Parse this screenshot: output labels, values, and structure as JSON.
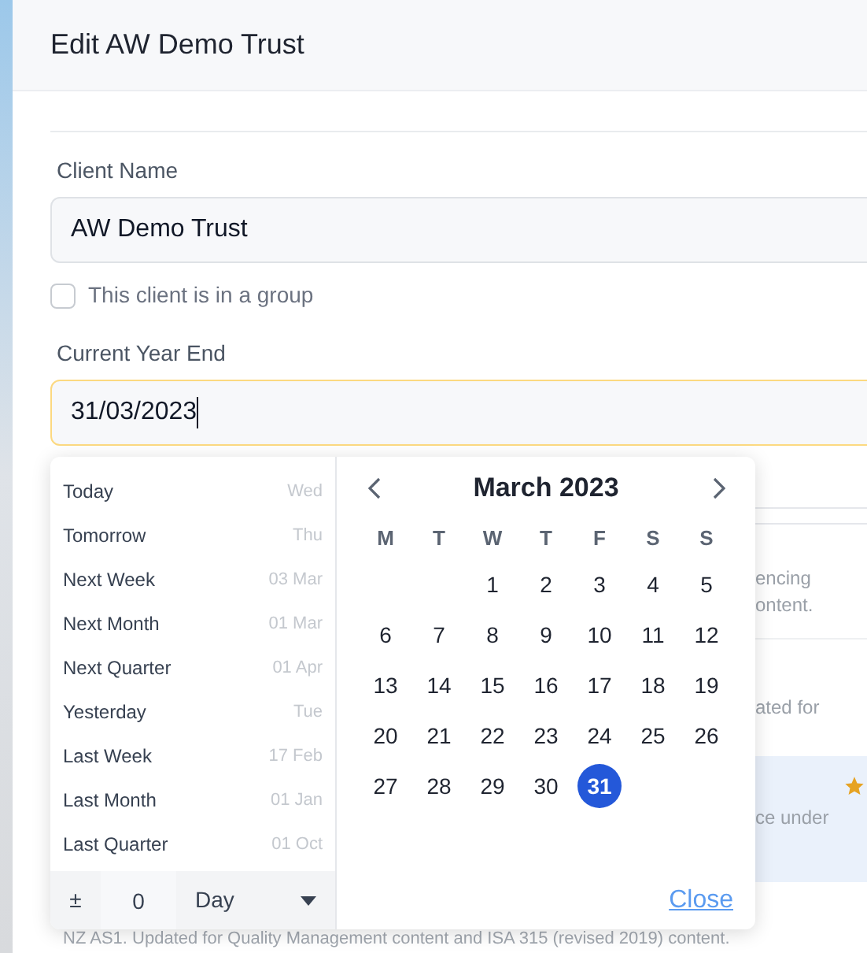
{
  "dialog": {
    "title": "Edit AW Demo Trust"
  },
  "client_name": {
    "label": "Client Name",
    "value": "AW Demo Trust"
  },
  "group_checkbox": {
    "label": "This client is in a group",
    "checked": false
  },
  "year_end": {
    "label": "Current Year End",
    "value": "31/03/2023"
  },
  "date_picker": {
    "shortcuts": [
      {
        "label": "Today",
        "hint": "Wed"
      },
      {
        "label": "Tomorrow",
        "hint": "Thu"
      },
      {
        "label": "Next Week",
        "hint": "03 Mar"
      },
      {
        "label": "Next Month",
        "hint": "01 Mar"
      },
      {
        "label": "Next Quarter",
        "hint": "01 Apr"
      },
      {
        "label": "Yesterday",
        "hint": "Tue"
      },
      {
        "label": "Last Week",
        "hint": "17 Feb"
      },
      {
        "label": "Last Month",
        "hint": "01 Jan"
      },
      {
        "label": "Last Quarter",
        "hint": "01 Oct"
      }
    ],
    "offset": {
      "sign": "±",
      "value": "0",
      "unit": "Day"
    },
    "month": "March 2023",
    "weekdays": [
      "M",
      "T",
      "W",
      "T",
      "F",
      "S",
      "S"
    ],
    "weeks": [
      [
        {
          "day": "1",
          "selected": false
        },
        {
          "day": "2",
          "selected": false
        },
        {
          "day": "3",
          "selected": false
        },
        {
          "day": "4",
          "selected": false
        },
        {
          "day": "5",
          "selected": false
        }
      ],
      [
        {
          "day": "6",
          "selected": false
        },
        {
          "day": "7",
          "selected": false
        },
        {
          "day": "8",
          "selected": false
        },
        {
          "day": "9",
          "selected": false
        },
        {
          "day": "10",
          "selected": false
        },
        {
          "day": "11",
          "selected": false
        },
        {
          "day": "12",
          "selected": false
        }
      ],
      [
        {
          "day": "13",
          "selected": false
        },
        {
          "day": "14",
          "selected": false
        },
        {
          "day": "15",
          "selected": false
        },
        {
          "day": "16",
          "selected": false
        },
        {
          "day": "17",
          "selected": false
        },
        {
          "day": "18",
          "selected": false
        },
        {
          "day": "19",
          "selected": false
        }
      ],
      [
        {
          "day": "20",
          "selected": false
        },
        {
          "day": "21",
          "selected": false
        },
        {
          "day": "22",
          "selected": false
        },
        {
          "day": "23",
          "selected": false
        },
        {
          "day": "24",
          "selected": false
        },
        {
          "day": "25",
          "selected": false
        },
        {
          "day": "26",
          "selected": false
        }
      ],
      [
        {
          "day": "27",
          "selected": false
        },
        {
          "day": "28",
          "selected": false
        },
        {
          "day": "29",
          "selected": false
        },
        {
          "day": "30",
          "selected": false
        },
        {
          "day": "31",
          "selected": true
        }
      ]
    ],
    "close": "Close"
  },
  "background_fragments": {
    "text_1": "encing",
    "text_2": "ontent.",
    "text_3": "ated for",
    "text_4": "ce under",
    "footer_text": "NZ AS1. Updated for Quality Management content and ISA 315 (revised 2019) content."
  }
}
